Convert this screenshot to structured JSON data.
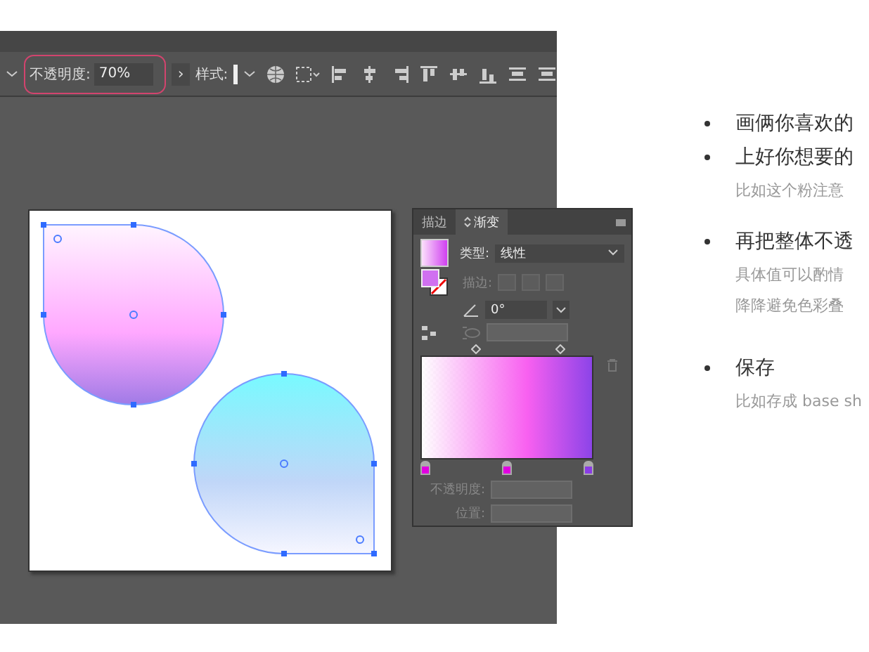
{
  "toolbar": {
    "opacity_label": "不透明度:",
    "opacity_value": "70%",
    "more_arrow": "›",
    "style_label": "样式:"
  },
  "gradient_panel": {
    "tabs": [
      {
        "label": "描边",
        "selected": false
      },
      {
        "label": "渐变",
        "selected": true
      }
    ],
    "type_label": "类型:",
    "type_value": "线性",
    "stroke_label": "描边:",
    "angle_value": "0°",
    "stops": [
      {
        "color": "#e000e0"
      },
      {
        "color": "#e000e0"
      },
      {
        "color": "#8a3ce6"
      }
    ],
    "opacity_label": "不透明度:",
    "position_label": "位置:"
  },
  "notes": [
    {
      "kind": "bullet",
      "text": "画俩你喜欢的"
    },
    {
      "kind": "bullet",
      "text": "上好你想要的"
    },
    {
      "kind": "sub",
      "text": "比如这个粉注意"
    },
    {
      "kind": "bullet",
      "text": "再把整体不透"
    },
    {
      "kind": "sub",
      "text": "具体值可以酌情"
    },
    {
      "kind": "sub",
      "text": "降降避免色彩叠"
    },
    {
      "kind": "bullet",
      "text": "保存"
    },
    {
      "kind": "sub",
      "text": "比如存成 base sh"
    }
  ]
}
